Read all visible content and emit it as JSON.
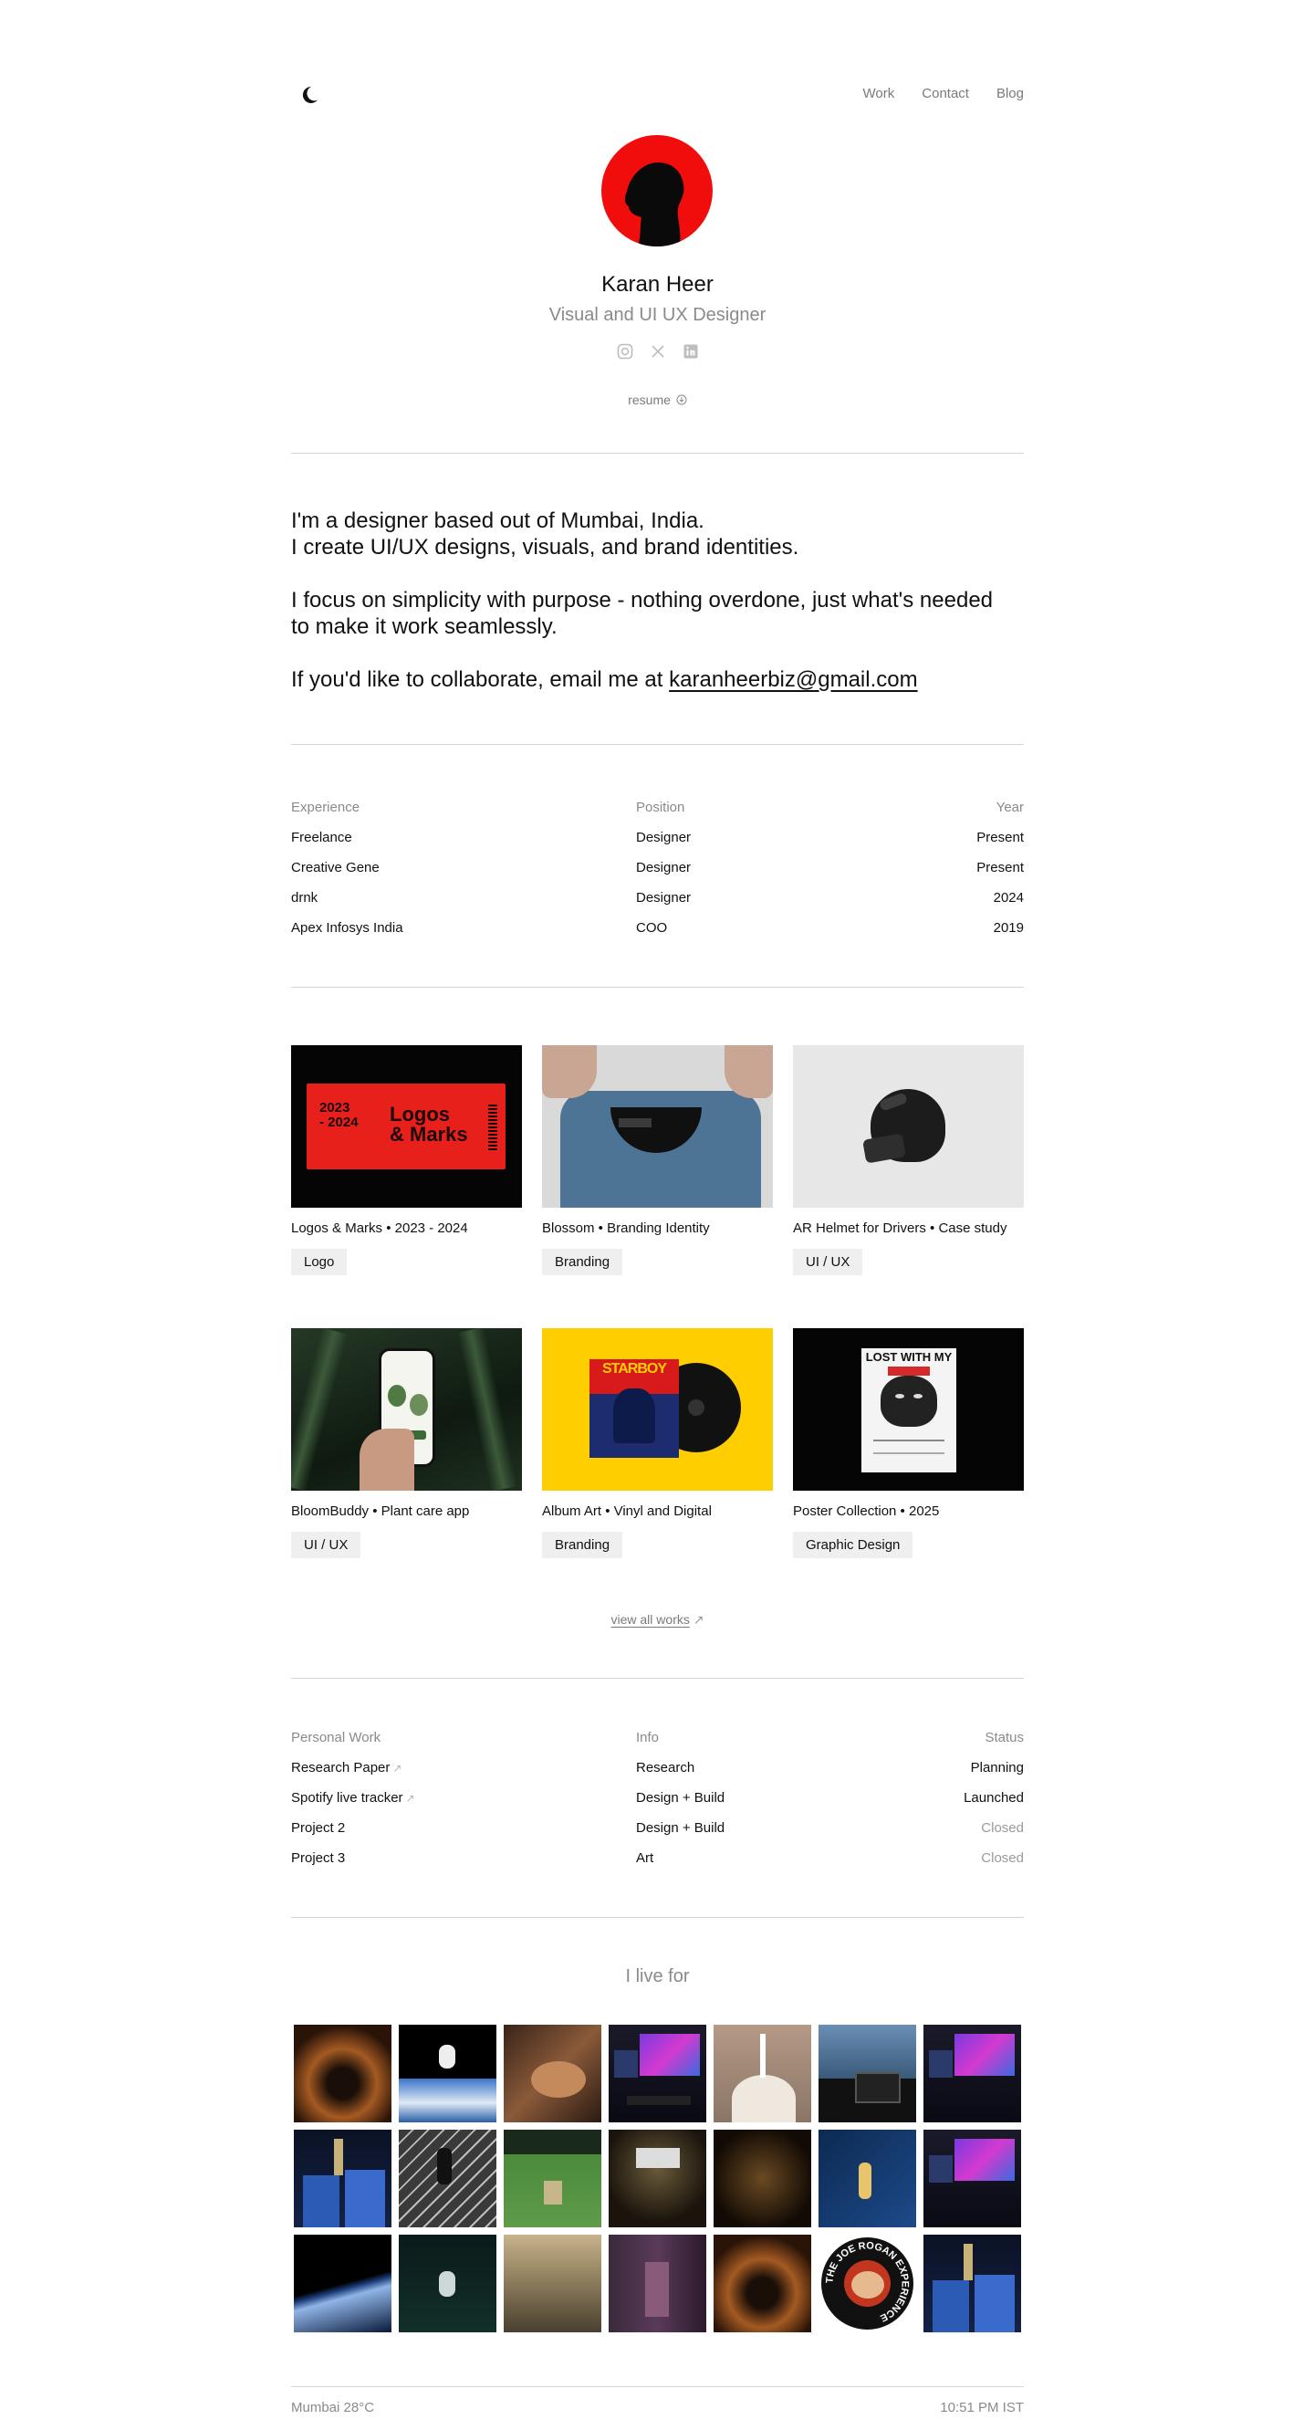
{
  "nav": {
    "items": [
      "Work",
      "Contact",
      "Blog"
    ]
  },
  "profile": {
    "name": "Karan Heer",
    "role": "Visual and UI UX Designer",
    "socials": [
      "instagram-icon",
      "x-icon",
      "linkedin-icon"
    ],
    "resume_label": "resume"
  },
  "intro": {
    "p1_line1": "I'm a designer based out of Mumbai, India.",
    "p1_line2": "I create UI/UX designs, visuals, and brand identities.",
    "p2": "I focus on simplicity with purpose - nothing overdone, just what's needed to make it work seamlessly.",
    "p3_prefix": "If you'd like to collaborate, email me at ",
    "email": "karanheerbiz@gmail.com"
  },
  "experience": {
    "headers": [
      "Experience",
      "Position",
      "Year"
    ],
    "rows": [
      [
        "Freelance",
        "Designer",
        "Present"
      ],
      [
        "Creative Gene",
        "Designer",
        "Present"
      ],
      [
        "drnk",
        "Designer",
        "2024"
      ],
      [
        "Apex Infosys India",
        "COO",
        "2019"
      ]
    ]
  },
  "works": [
    {
      "title": "Logos & Marks • 2023 - 2024",
      "tag": "Logo",
      "thumb_text_year": "2023\n- 2024",
      "thumb_text": "Logos\n& Marks"
    },
    {
      "title": "Blossom • Branding Identity",
      "tag": "Branding"
    },
    {
      "title": "AR Helmet for Drivers • Case study",
      "tag": "UI / UX"
    },
    {
      "title": "BloomBuddy • Plant care app",
      "tag": "UI / UX"
    },
    {
      "title": "Album Art • Vinyl and Digital",
      "tag": "Branding",
      "thumb_text": "STARBOY"
    },
    {
      "title": "Poster Collection • 2025",
      "tag": "Graphic Design",
      "thumb_text": "LOST WITH MY"
    }
  ],
  "view_all": "view all works",
  "personal": {
    "headers": [
      "Personal Work",
      "Info",
      "Status"
    ],
    "rows": [
      {
        "name": "Research Paper",
        "info": "Research",
        "status": "Planning",
        "link": true,
        "muted": false
      },
      {
        "name": "Spotify live tracker",
        "info": "Design + Build",
        "status": "Launched",
        "link": true,
        "muted": false
      },
      {
        "name": "Project 2",
        "info": "Design + Build",
        "status": "Closed",
        "link": false,
        "muted": true
      },
      {
        "name": "Project 3",
        "info": "Art",
        "status": "Closed",
        "link": false,
        "muted": true
      }
    ]
  },
  "live_for": {
    "title": "I live for",
    "photos": [
      "cave",
      "astronaut-earth",
      "guitar",
      "gaming-setup",
      "rocket-launch",
      "city-desk",
      "gaming-setup",
      "cricket-celebration",
      "runner-track",
      "cricket-stadium",
      "ufc-arena",
      "chess",
      "tennis",
      "gaming-setup",
      "earth-orbit",
      "astronaut-night",
      "boats",
      "village-street",
      "cave",
      "joe-rogan-experience",
      "cricket-celebration"
    ],
    "badge_text": "THE JOE ROGAN EXPERIENCE"
  },
  "footer": {
    "left": "Mumbai 28°C",
    "right": "10:51 PM IST"
  },
  "colors": {
    "accent_red": "#f20d0d",
    "muted": "#8a8a8a",
    "rule": "#d4d4d4",
    "tag_bg": "#efefef"
  }
}
